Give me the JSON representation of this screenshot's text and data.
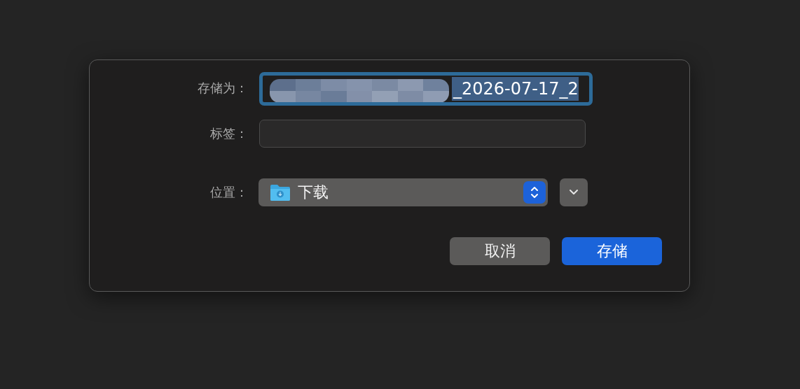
{
  "save_as": {
    "label": "存储为：",
    "value": "_2026-07-17_2",
    "focused": true,
    "text_selected": true,
    "redacted": true
  },
  "tags": {
    "label": "标签："
  },
  "location": {
    "label": "位置：",
    "value": "下载",
    "expanded": false
  },
  "buttons": [
    {
      "label": "取消",
      "kind": "cancel"
    },
    {
      "label": "存储",
      "kind": "default"
    }
  ]
}
